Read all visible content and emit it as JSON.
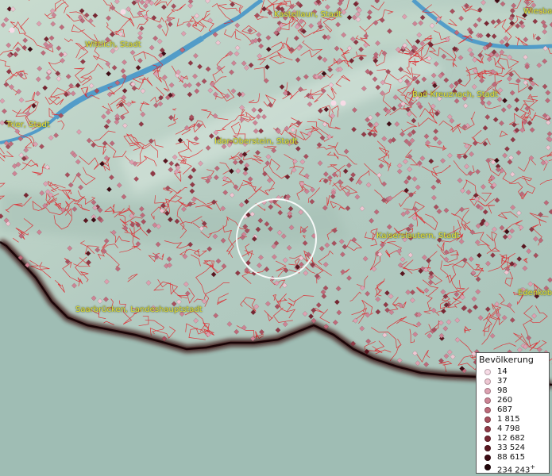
{
  "map": {
    "cities": [
      {
        "id": "kastellaun",
        "name": "Kastellaun, Stadt"
      },
      {
        "id": "wiesbaden",
        "name": "Wiesbad"
      },
      {
        "id": "wittlich",
        "name": "Wittlich, Stadt"
      },
      {
        "id": "bad-kreuznach",
        "name": "Bad Kreuznach, Stadt"
      },
      {
        "id": "trier",
        "name": "Trier, Stadt"
      },
      {
        "id": "idar-oberstein",
        "name": "Idar-Oberstein, Stadt"
      },
      {
        "id": "kaiserslautern",
        "name": "Kaiserslautern, Stadt"
      },
      {
        "id": "saarbruecken",
        "name": "Saarbrücken, Landeshauptstadt"
      },
      {
        "id": "edenkoben",
        "name": "Edenkob"
      }
    ],
    "colors": {
      "land": "#b9cfc6",
      "outside": "#9fbdb4",
      "border": "#3a0f10",
      "boundaries": "#e0262c",
      "water": "#3f93c9",
      "selection": "#ffffff"
    }
  },
  "legend": {
    "title": "Bevölkerung",
    "classes": [
      {
        "label": "14",
        "color": "#f7dbe6"
      },
      {
        "label": "37",
        "color": "#eec6d2"
      },
      {
        "label": "98",
        "color": "#dda1b1"
      },
      {
        "label": "260",
        "color": "#cd8495"
      },
      {
        "label": "687",
        "color": "#bd6a7a"
      },
      {
        "label": "1 815",
        "color": "#a8505e"
      },
      {
        "label": "4 798",
        "color": "#913a47"
      },
      {
        "label": "12 682",
        "color": "#772632"
      },
      {
        "label": "33 524",
        "color": "#5a1620"
      },
      {
        "label": "88 615",
        "color": "#3d0c14"
      },
      {
        "label": "234 243",
        "color": "#21060a",
        "suffix": "+"
      }
    ]
  }
}
